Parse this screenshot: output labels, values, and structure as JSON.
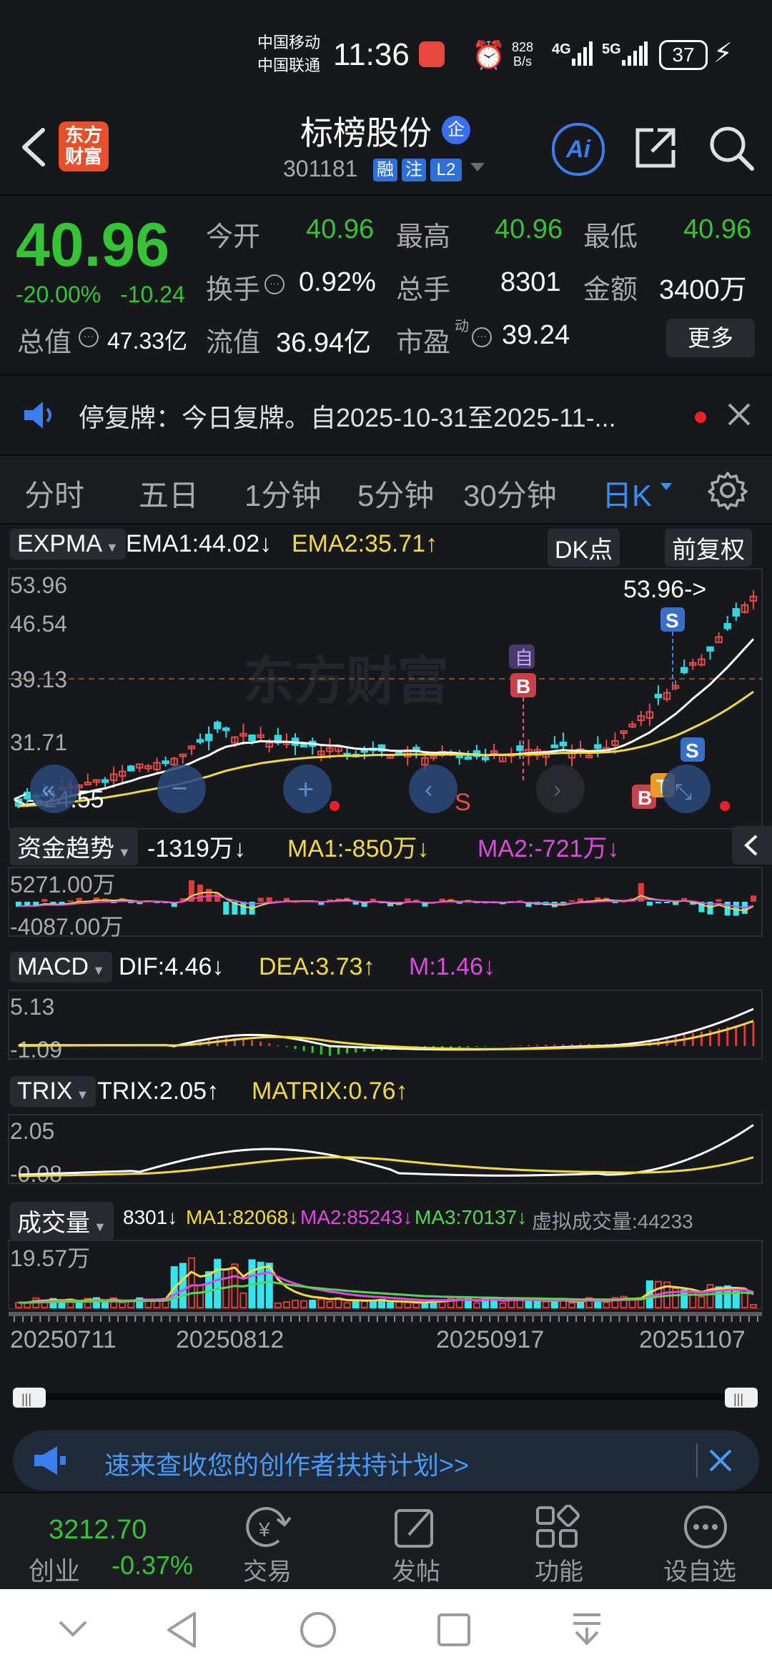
{
  "status_bar": {
    "carrier1": "中国移动",
    "carrier2": "中国联通",
    "time": "11:36",
    "net_speed_top": "828",
    "net_speed_bottom": "B/s",
    "net1": "4G",
    "net2": "5G",
    "battery": "37"
  },
  "header": {
    "logo_line1": "东方",
    "logo_line2": "财富",
    "stock_name": "标榜股份",
    "enterprise_badge": "企",
    "code": "301181",
    "tag_margin": "融",
    "tag_watch": "注",
    "tag_level": "L2",
    "ai_label": "Ai"
  },
  "quote": {
    "price": "40.96",
    "change_pct": "-20.00%",
    "change": "-10.24",
    "open_label": "今开",
    "open_value": "40.96",
    "high_label": "最高",
    "high_value": "40.96",
    "low_label": "最低",
    "low_value": "40.96",
    "turnover_label": "换手",
    "turnover_value": "0.92%",
    "volume_label": "总手",
    "volume_value": "8301",
    "amount_label": "金额",
    "amount_value": "3400万",
    "mktcap_label": "总值",
    "mktcap_value": "47.33亿",
    "float_label": "流值",
    "float_value": "36.94亿",
    "pe_label": "市盈",
    "pe_sup": "动",
    "pe_value": "39.24",
    "more_button": "更多"
  },
  "notice": {
    "text": "停复牌：今日复牌。自2025-10-31至2025-11-..."
  },
  "tabs": {
    "items": [
      "分时",
      "五日",
      "1分钟",
      "5分钟",
      "30分钟",
      "日K"
    ],
    "active_index": 5
  },
  "kline": {
    "indicator": "EXPMA",
    "ema1": "EMA1:44.02",
    "ema2": "EMA2:35.71",
    "dk_button": "DK点",
    "adjust_button": "前复权",
    "y_labels": [
      "53.96",
      "46.54",
      "39.13",
      "31.71"
    ],
    "high_marker": "53.96->",
    "low_marker": "<--24.55",
    "sell_marker": "S",
    "custom_marker": "自"
  },
  "fund_flow": {
    "indicator": "资金趋势",
    "value": "-1319万",
    "ma1": "MA1:-850万",
    "ma2": "MA2:-721万",
    "y_top": "5271.00万",
    "y_bottom": "-4087.00万"
  },
  "macd": {
    "indicator": "MACD",
    "dif": "DIF:4.46",
    "dea": "DEA:3.73",
    "m": "M:1.46",
    "y_top": "5.13",
    "y_bottom": "-1.09"
  },
  "trix": {
    "indicator": "TRIX",
    "trix": "TRIX:2.05",
    "matrix": "MATRIX:0.76",
    "y_top": "2.05",
    "y_bottom": "-0.08"
  },
  "volume": {
    "indicator": "成交量",
    "value": "8301",
    "ma1": "MA1:82068",
    "ma2": "MA2:85243",
    "ma3": "MA3:70137",
    "virtual": "虚拟成交量:44233",
    "y_top": "19.57万"
  },
  "dates": [
    "20250711",
    "20250812",
    "20250917",
    "20251107"
  ],
  "banner": {
    "text": "速来查收您的创作者扶持计划>>"
  },
  "bottom_nav": {
    "index_value": "3212.70",
    "index_name": "创业",
    "index_change": "-0.37%",
    "trade": "交易",
    "post": "发帖",
    "features": "功能",
    "set_watch": "设自选"
  },
  "colors": {
    "up": "#e84a4a",
    "down": "#35c435",
    "accent": "#2f8ef0",
    "ema1_line": "#ffffff",
    "ema2_line": "#f2dc3b",
    "background": "#17181c"
  }
}
